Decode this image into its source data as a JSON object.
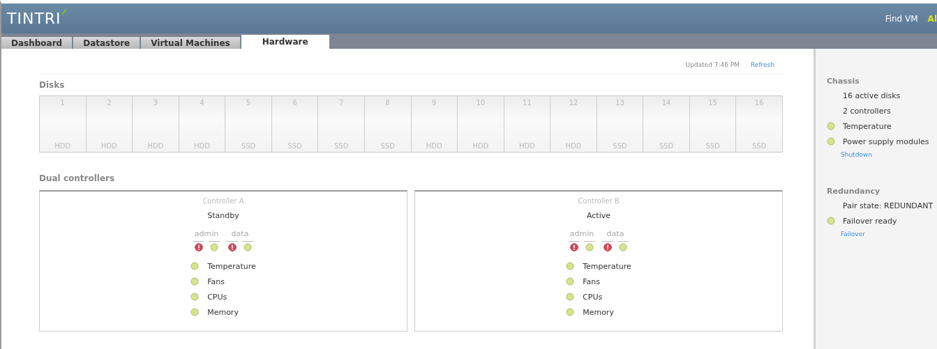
{
  "header": {
    "logo": "TINTRI",
    "links": [
      {
        "label": "Find VM",
        "kind": "plain"
      },
      {
        "label": "Al",
        "kind": "alert"
      }
    ]
  },
  "tabs": [
    {
      "label": "Dashboard",
      "selected": false
    },
    {
      "label": "Datastore",
      "selected": false
    },
    {
      "label": "Virtual Machines",
      "selected": false
    },
    {
      "label": "Hardware",
      "selected": true
    }
  ],
  "updated": "Updated 7:46 PM",
  "refresh": "Refresh",
  "disks": {
    "title": "Disks",
    "items": [
      {
        "number": "1",
        "type": "HDD"
      },
      {
        "number": "2",
        "type": "HDD"
      },
      {
        "number": "3",
        "type": "HDD"
      },
      {
        "number": "4",
        "type": "HDD"
      },
      {
        "number": "5",
        "type": "SSD"
      },
      {
        "number": "6",
        "type": "SSD"
      },
      {
        "number": "7",
        "type": "SSD"
      },
      {
        "number": "8",
        "type": "SSD"
      },
      {
        "number": "9",
        "type": "HDD"
      },
      {
        "number": "10",
        "type": "HDD"
      },
      {
        "number": "11",
        "type": "HDD"
      },
      {
        "number": "12",
        "type": "HDD"
      },
      {
        "number": "13",
        "type": "SSD"
      },
      {
        "number": "14",
        "type": "SSD"
      },
      {
        "number": "15",
        "type": "SSD"
      },
      {
        "number": "16",
        "type": "SSD"
      }
    ]
  },
  "controllers": {
    "title": "Dual controllers",
    "items": [
      {
        "name": "Controller A",
        "state": "Standby",
        "ports": [
          {
            "label": "admin",
            "lights": [
              {
                "error": true
              },
              {
                "error": false
              }
            ]
          },
          {
            "label": "data",
            "lights": [
              {
                "error": true
              },
              {
                "error": false
              }
            ]
          }
        ],
        "checks": [
          {
            "label": "Temperature",
            "ok": true
          },
          {
            "label": "Fans",
            "ok": true
          },
          {
            "label": "CPUs",
            "ok": true
          },
          {
            "label": "Memory",
            "ok": true
          }
        ]
      },
      {
        "name": "Controller B",
        "state": "Active",
        "ports": [
          {
            "label": "admin",
            "lights": [
              {
                "error": true
              },
              {
                "error": false
              }
            ]
          },
          {
            "label": "data",
            "lights": [
              {
                "error": true
              },
              {
                "error": false
              }
            ]
          }
        ],
        "checks": [
          {
            "label": "Temperature",
            "ok": true
          },
          {
            "label": "Fans",
            "ok": true
          },
          {
            "label": "CPUs",
            "ok": true
          },
          {
            "label": "Memory",
            "ok": true
          }
        ]
      }
    ]
  },
  "sidebar": [
    {
      "title": "Chassis",
      "items": [
        {
          "label": "16 active disks",
          "kind": "plain"
        },
        {
          "label": "2 controllers",
          "kind": "plain"
        },
        {
          "label": "Temperature",
          "kind": "status",
          "ok": true
        },
        {
          "label": "Power supply modules",
          "kind": "status",
          "ok": true
        }
      ],
      "action": "Shutdown"
    },
    {
      "title": "Redundancy",
      "items": [
        {
          "label": "Pair state: REDUNDANT",
          "kind": "plain"
        },
        {
          "label": "Failover ready",
          "kind": "status",
          "ok": true
        }
      ],
      "action": "Failover"
    }
  ]
}
